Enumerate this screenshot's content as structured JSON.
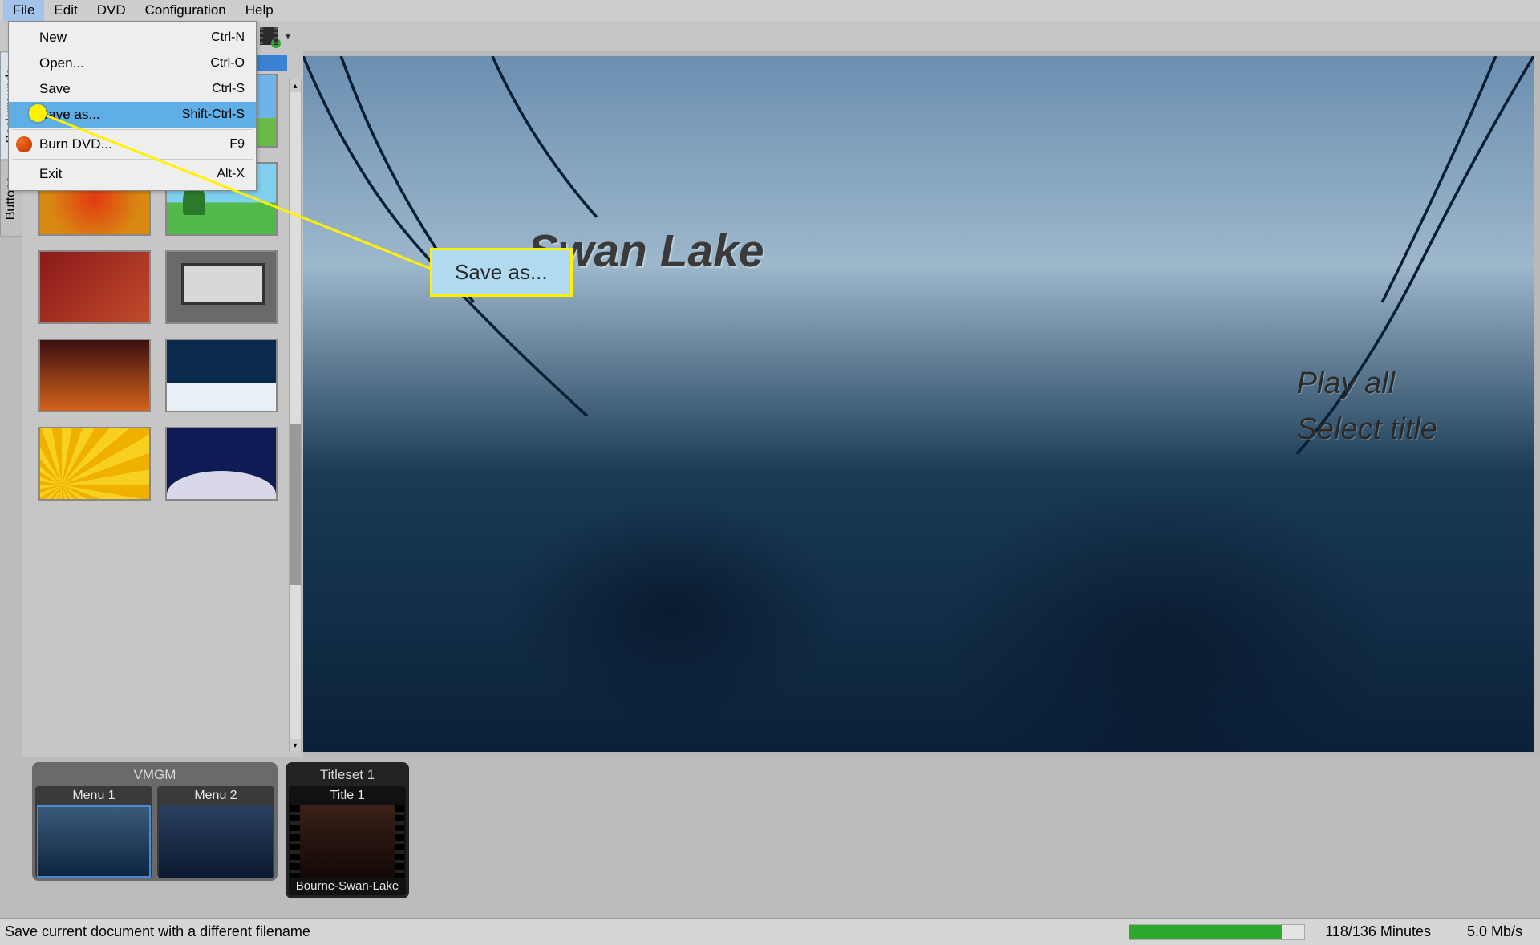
{
  "menubar": [
    "File",
    "Edit",
    "DVD",
    "Configuration",
    "Help"
  ],
  "file_menu": [
    {
      "label": "New",
      "shortcut": "Ctrl-N"
    },
    {
      "label": "Open...",
      "shortcut": "Ctrl-O"
    },
    {
      "label": "Save",
      "shortcut": "Ctrl-S"
    },
    {
      "label": "Save as...",
      "shortcut": "Shift-Ctrl-S",
      "highlight": true
    },
    {
      "label": "Burn DVD...",
      "shortcut": "F9",
      "icon": "burn"
    },
    {
      "label": "Exit",
      "shortcut": "Alt-X"
    }
  ],
  "sidebar_tabs": {
    "backgrounds": "Backgrounds",
    "buttons": "Buttons"
  },
  "callout": {
    "label": "Save as..."
  },
  "preview": {
    "title": "Swan Lake",
    "menu_items": [
      "Play all",
      "Select title"
    ]
  },
  "timeline": {
    "group1": {
      "header": "VMGM",
      "items": [
        {
          "title": "Menu 1"
        },
        {
          "title": "Menu 2"
        }
      ]
    },
    "group2": {
      "header": "Titleset 1",
      "items": [
        {
          "title": "Title 1",
          "caption": "Bourne-Swan-Lake"
        }
      ]
    }
  },
  "statusbar": {
    "text": "Save current document with a different filename",
    "minutes": "118/136 Minutes",
    "bitrate": "5.0 Mb/s"
  }
}
